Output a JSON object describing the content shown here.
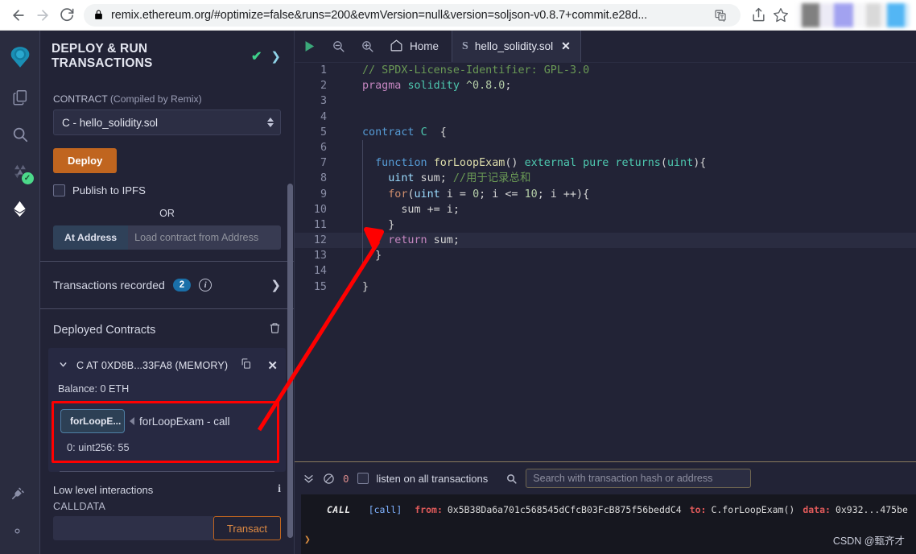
{
  "browser": {
    "url": "remix.ethereum.org/#optimize=false&runs=200&evmVersion=null&version=soljson-v0.8.7+commit.e28d...",
    "back_label": "Back",
    "forward_label": "Forward",
    "reload_label": "Reload",
    "lock_label": "View site information",
    "translate_label": "Translate this page",
    "share_label": "Share this page",
    "bookmark_label": "Bookmark this tab"
  },
  "rail": {
    "items": [
      {
        "name": "remix-logo",
        "label": "Remix"
      },
      {
        "name": "file-explorer",
        "label": "File explorers"
      },
      {
        "name": "search",
        "label": "Search in files"
      },
      {
        "name": "solidity-compiler",
        "label": "Solidity compiler"
      },
      {
        "name": "deploy-run",
        "label": "Deploy & run transactions"
      }
    ],
    "bottom_items": [
      {
        "name": "plugin-manager",
        "label": "Plugin manager"
      },
      {
        "name": "settings",
        "label": "Settings"
      }
    ],
    "compile_status": "✓"
  },
  "panel": {
    "title": "DEPLOY & RUN TRANSACTIONS",
    "title_check": "✔",
    "title_chevron": "❯",
    "contract_label": "CONTRACT",
    "contract_sublabel": "(Compiled by Remix)",
    "contract_value": "C - hello_solidity.sol",
    "deploy_label": "Deploy",
    "publish_ipfs_label": "Publish to IPFS",
    "or_label": "OR",
    "at_address_label": "At Address",
    "at_address_placeholder": "Load contract from Address",
    "transactions_recorded_label": "Transactions recorded",
    "transactions_recorded_count": "2",
    "transactions_info": "i",
    "transactions_chevron": "❯",
    "deployed_contracts_label": "Deployed Contracts",
    "contract_instance_name": "C AT 0XD8B...33FA8 (MEMORY)",
    "contract_caret": "⌄",
    "contract_close": "✕",
    "balance_label": "Balance: 0 ETH",
    "fn_button_label": "forLoopE...",
    "fn_call_label": "forLoopExam - call",
    "fn_result": "0: uint256: 55",
    "low_level_label": "Low level interactions",
    "low_level_info": "i",
    "calldata_label": "CALLDATA",
    "calldata_value": "",
    "calldata_placeholder": "",
    "transact_label": "Transact"
  },
  "editor": {
    "run_label": "Run script",
    "zoom_out_label": "Zoom out",
    "zoom_in_label": "Zoom in",
    "home_label": "Home",
    "file_tab_label": "hello_solidity.sol",
    "file_tab_glyph": "S",
    "file_tab_close": "✕",
    "active_line": 12,
    "lines": [
      {
        "n": "1",
        "tokens": [
          {
            "c": "k-comment",
            "t": "// SPDX-License-Identifier: GPL-3.0"
          }
        ]
      },
      {
        "n": "2",
        "tokens": [
          {
            "c": "k-kw2",
            "t": "pragma "
          },
          {
            "c": "k-type",
            "t": "solidity "
          },
          {
            "c": "k-num",
            "t": "^0.8.0"
          },
          {
            "c": "k-plain",
            "t": ";"
          }
        ]
      },
      {
        "n": "3",
        "tokens": []
      },
      {
        "n": "4",
        "tokens": []
      },
      {
        "n": "5",
        "tokens": [
          {
            "c": "k-kw",
            "t": "contract "
          },
          {
            "c": "k-type",
            "t": "C "
          },
          {
            "c": "k-plain",
            "t": " {"
          }
        ]
      },
      {
        "n": "6",
        "tokens": []
      },
      {
        "n": "7",
        "tokens": [
          {
            "c": "k-plain",
            "t": "  "
          },
          {
            "c": "k-kw",
            "t": "function "
          },
          {
            "c": "k-fn",
            "t": "forLoopExam"
          },
          {
            "c": "k-plain",
            "t": "() "
          },
          {
            "c": "k-type",
            "t": "external pure returns"
          },
          {
            "c": "k-plain",
            "t": "("
          },
          {
            "c": "k-type",
            "t": "uint"
          },
          {
            "c": "k-plain",
            "t": "){"
          }
        ]
      },
      {
        "n": "8",
        "tokens": [
          {
            "c": "k-plain",
            "t": "    "
          },
          {
            "c": "k-var",
            "t": "uint"
          },
          {
            "c": "k-plain",
            "t": " sum; "
          },
          {
            "c": "k-comment",
            "t": "//用于记录总和"
          }
        ]
      },
      {
        "n": "9",
        "tokens": [
          {
            "c": "k-plain",
            "t": "    "
          },
          {
            "c": "k-ctrl",
            "t": "for"
          },
          {
            "c": "k-plain",
            "t": "("
          },
          {
            "c": "k-var",
            "t": "uint"
          },
          {
            "c": "k-plain",
            "t": " i = "
          },
          {
            "c": "k-num",
            "t": "0"
          },
          {
            "c": "k-plain",
            "t": "; i <= "
          },
          {
            "c": "k-num",
            "t": "10"
          },
          {
            "c": "k-plain",
            "t": "; i ++){"
          }
        ]
      },
      {
        "n": "10",
        "tokens": [
          {
            "c": "k-plain",
            "t": "      sum += i;"
          }
        ]
      },
      {
        "n": "11",
        "tokens": [
          {
            "c": "k-plain",
            "t": "    }"
          }
        ]
      },
      {
        "n": "12",
        "tokens": [
          {
            "c": "k-plain",
            "t": "    "
          },
          {
            "c": "k-kw2",
            "t": "return"
          },
          {
            "c": "k-plain",
            "t": " sum;"
          }
        ]
      },
      {
        "n": "13",
        "tokens": [
          {
            "c": "k-plain",
            "t": "  }"
          }
        ]
      },
      {
        "n": "14",
        "tokens": []
      },
      {
        "n": "15",
        "tokens": [
          {
            "c": "k-plain",
            "t": "}"
          }
        ]
      }
    ]
  },
  "terminal": {
    "collapse_label": "Toggle terminal",
    "clear_label": "Clear console",
    "pending_count": "0",
    "listen_label": "listen on all transactions",
    "search_icon_label": "search-icon",
    "search_placeholder": "Search with transaction hash or address",
    "prompt": "❯",
    "log": {
      "badge": "CALL",
      "bracket": "[call]",
      "from_key": "from:",
      "from_val": "0x5B38Da6a701c568545dCfcB03FcB875f56beddC4",
      "to_key": "to:",
      "to_val": "C.forLoopExam()",
      "data_key": "data:",
      "data_val": "0x932...475be"
    }
  },
  "watermark": "CSDN @甄齐才",
  "colors": {
    "accent_orange": "#c0651f",
    "success_green": "#4cd98a",
    "badge_blue": "#1a6fa8",
    "highlight_red": "#ff0000",
    "panel_bg": "#222336"
  }
}
